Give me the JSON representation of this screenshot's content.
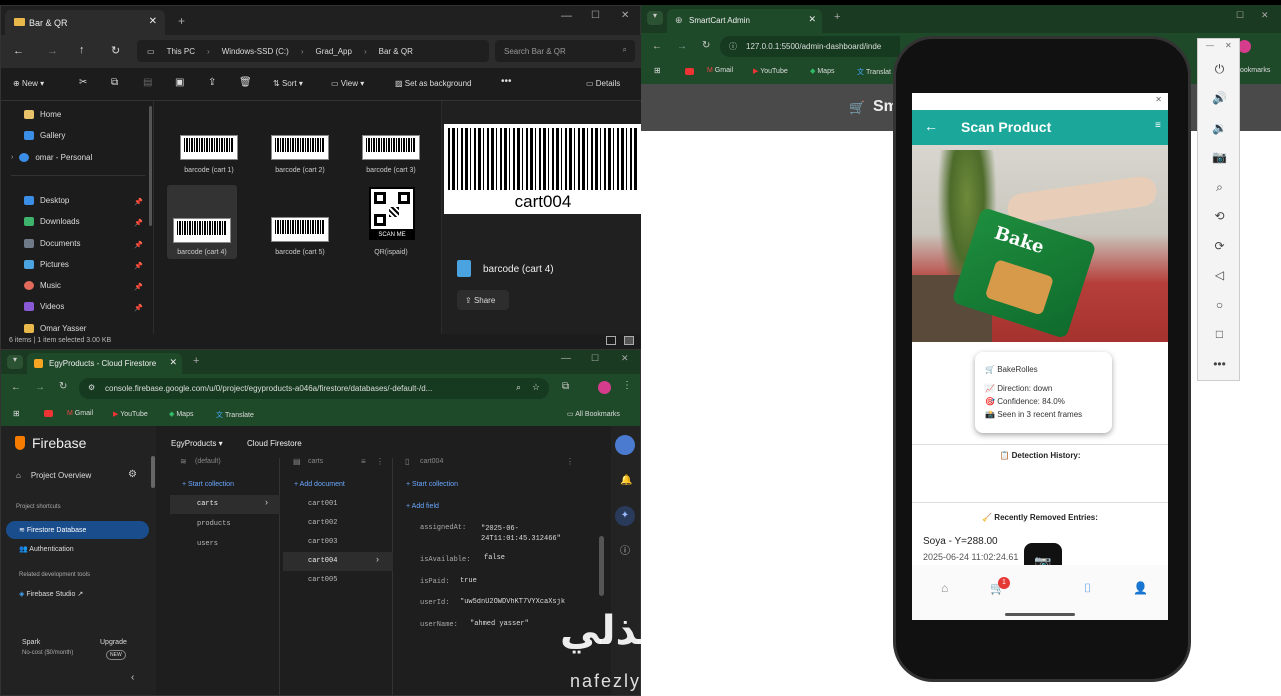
{
  "explorer": {
    "tab_title": "Bar & QR",
    "breadcrumb": [
      "This PC",
      "Windows-SSD (C:)",
      "Grad_App",
      "Bar & QR"
    ],
    "search_placeholder": "Search Bar & QR",
    "toolbar": {
      "new": "New",
      "sort": "Sort",
      "view": "View",
      "set_bg": "Set as background",
      "details": "Details"
    },
    "sidebar": [
      "Home",
      "Gallery",
      "omar - Personal",
      "Desktop",
      "Downloads",
      "Documents",
      "Pictures",
      "Music",
      "Videos",
      "Omar Yasser"
    ],
    "files": [
      "barcode (cart 1)",
      "barcode (cart 2)",
      "barcode (cart 3)",
      "barcode (cart 4)",
      "barcode (cart 5)",
      "QR(ispaid)"
    ],
    "qr_caption": "SCAN ME",
    "status": "6 items  |  1 item selected  3.00 KB",
    "preview": {
      "barcode_text": "cart004",
      "file_name": "barcode (cart 4)",
      "share": "Share"
    }
  },
  "firebase_browser": {
    "tab_title": "EgyProducts - Cloud Firestore",
    "url": "console.firebase.google.com/u/0/project/egyproducts-a046a/firestore/databases/-default-/d...",
    "bookmarks": [
      "Gmail",
      "YouTube",
      "Maps",
      "Translate"
    ],
    "all_bookmarks": "All Bookmarks",
    "brand": "Firebase",
    "project": "EgyProducts",
    "service": "Cloud Firestore",
    "nav": {
      "overview": "Project Overview",
      "shortcuts": "Project shortcuts",
      "firestore": "Firestore Database",
      "auth": "Authentication",
      "related": "Related development tools",
      "studio": "Firebase Studio",
      "plan": "Spark",
      "plan_sub": "No-cost ($0/month)",
      "upgrade": "Upgrade",
      "new_badge": "NEW"
    },
    "col1": {
      "header": "(default)",
      "action": "Start collection",
      "items": [
        "carts",
        "products",
        "users"
      ]
    },
    "col2": {
      "header": "carts",
      "action": "Add document",
      "items": [
        "cart001",
        "cart002",
        "cart003",
        "cart004",
        "cart005"
      ]
    },
    "col3": {
      "header": "cart004",
      "action1": "Start collection",
      "action2": "Add field",
      "fields": [
        {
          "key": "assignedAt:",
          "value": "\"2025-06-24T11:01:45.312466\""
        },
        {
          "key": "isAvailable:",
          "value": "false"
        },
        {
          "key": "isPaid:",
          "value": "true"
        },
        {
          "key": "userId:",
          "value": "\"uw5dnU2OWDVhKT7VYXcaXsjk"
        },
        {
          "key": "userName:",
          "value": "\"ahmed yasser\""
        }
      ]
    }
  },
  "smartcart_browser": {
    "tab_title": "SmartCart Admin",
    "url": "127.0.0.1:5500/admin-dashboard/inde",
    "bookmarks": [
      "Gmail",
      "YouTube",
      "Maps",
      "Translat"
    ],
    "bookmarks_right": "ookmarks",
    "header_text": "Sm"
  },
  "phone_app": {
    "title": "Scan Product",
    "detection": {
      "product": "BakeRolles",
      "direction": "Direction: down",
      "confidence": "Confidence: 84.0%",
      "frames": "Seen in 3 recent frames"
    },
    "history_title": "Detection History:",
    "removed_title": "Recently Removed Entries:",
    "removed_item": "Soya - Y=288.00",
    "removed_time": "2025-06-24 11:02:24.61",
    "cart_badge": "1"
  },
  "watermark": {
    "arabic": "نفذلي",
    "latin": "nafezly.com"
  },
  "colors": {
    "teal": "#1ba79a",
    "chrome_green": "#1b3a22",
    "firebase_blue": "#1a73e8"
  }
}
